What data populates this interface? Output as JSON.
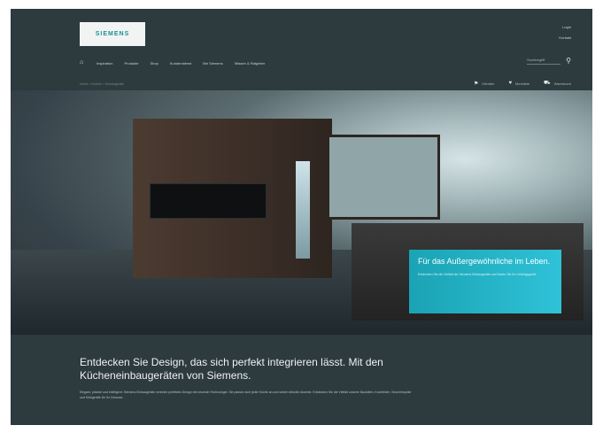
{
  "header": {
    "logo_text": "SIEMENS",
    "util_links": [
      "Login",
      "Kontakt"
    ],
    "nav": [
      "Inspiration",
      "Produkte",
      "Shop",
      "Kundendienst",
      "Bei Siemens",
      "Wissen & Ratgeber"
    ],
    "search_placeholder": "Suchbegriff",
    "breadcrumb": "Home > Kochen > Einbaugeräte",
    "tools": [
      "Händler",
      "Merkliste",
      "Warenkorb"
    ]
  },
  "hero": {
    "promo_title": "Für das Außergewöhnliche im Leben.",
    "promo_text": "Entdecken Sie die Vielfalt der Siemens Einbaugeräte und finden Sie Ihr Lieblingsgerät."
  },
  "content": {
    "headline": "Entdecken Sie Design, das sich perfekt integrieren lässt. Mit den Kücheneinbaugeräten von Siemens.",
    "body": "Elegant, präzise und intelligent: Siemens Einbaugeräte vereinen perfektes Design mit neuester Technologie. Sie passen sich jeder Küche an und setzen stilvolle Akzente. Entdecken Sie die Vielfalt unserer Backöfen, Kochfelder, Geschirrspüler und Kühlgeräte für Ihr Zuhause."
  }
}
